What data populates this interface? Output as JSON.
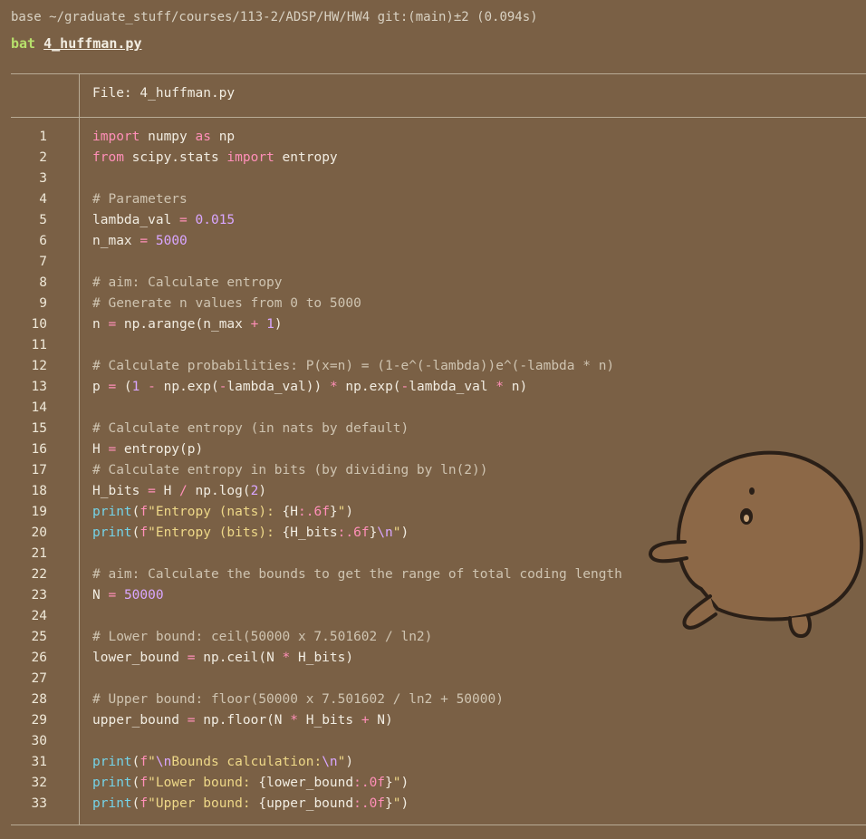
{
  "terminal": {
    "prompt": "base ~/graduate_stuff/courses/113-2/ADSP/HW/HW4 git:(main)±2 (0.094s)",
    "command": "bat",
    "argument": "4_huffman.py"
  },
  "file_header": "File: 4_huffman.py",
  "sticker": {
    "icon": "round-blob-creature-icon"
  },
  "colors": {
    "background": "#7a6045",
    "keyword": "#ff8fb8",
    "number": "#d9a6ff",
    "comment": "#cfc4b1",
    "function": "#74d3e8",
    "string": "#eed888"
  },
  "code": [
    {
      "n": "1",
      "t": [
        [
          "kw",
          "import"
        ],
        [
          "id",
          " numpy "
        ],
        [
          "kw",
          "as"
        ],
        [
          "id",
          " np"
        ]
      ]
    },
    {
      "n": "2",
      "t": [
        [
          "kw",
          "from"
        ],
        [
          "id",
          " scipy.stats "
        ],
        [
          "kw",
          "import"
        ],
        [
          "id",
          " entropy"
        ]
      ]
    },
    {
      "n": "3",
      "t": []
    },
    {
      "n": "4",
      "t": [
        [
          "cmt",
          "# Parameters"
        ]
      ]
    },
    {
      "n": "5",
      "t": [
        [
          "id",
          "lambda_val "
        ],
        [
          "op",
          "="
        ],
        [
          "id",
          " "
        ],
        [
          "num",
          "0.015"
        ]
      ]
    },
    {
      "n": "6",
      "t": [
        [
          "id",
          "n_max "
        ],
        [
          "op",
          "="
        ],
        [
          "id",
          " "
        ],
        [
          "num",
          "5000"
        ]
      ]
    },
    {
      "n": "7",
      "t": []
    },
    {
      "n": "8",
      "t": [
        [
          "cmt",
          "# aim: Calculate entropy"
        ]
      ]
    },
    {
      "n": "9",
      "t": [
        [
          "cmt",
          "# Generate n values from 0 to 5000"
        ]
      ]
    },
    {
      "n": "10",
      "t": [
        [
          "id",
          "n "
        ],
        [
          "op",
          "="
        ],
        [
          "id",
          " np.arange(n_max "
        ],
        [
          "op",
          "+"
        ],
        [
          "id",
          " "
        ],
        [
          "num",
          "1"
        ],
        [
          "id",
          ")"
        ]
      ]
    },
    {
      "n": "11",
      "t": []
    },
    {
      "n": "12",
      "t": [
        [
          "cmt",
          "# Calculate probabilities: P(x=n) = (1-e^(-lambda))e^(-lambda * n)"
        ]
      ]
    },
    {
      "n": "13",
      "t": [
        [
          "id",
          "p "
        ],
        [
          "op",
          "="
        ],
        [
          "id",
          " ("
        ],
        [
          "num",
          "1"
        ],
        [
          "id",
          " "
        ],
        [
          "op",
          "-"
        ],
        [
          "id",
          " np.exp("
        ],
        [
          "op",
          "-"
        ],
        [
          "id",
          "lambda_val)) "
        ],
        [
          "op",
          "*"
        ],
        [
          "id",
          " np.exp("
        ],
        [
          "op",
          "-"
        ],
        [
          "id",
          "lambda_val "
        ],
        [
          "op",
          "*"
        ],
        [
          "id",
          " n)"
        ]
      ]
    },
    {
      "n": "14",
      "t": []
    },
    {
      "n": "15",
      "t": [
        [
          "cmt",
          "# Calculate entropy (in nats by default)"
        ]
      ]
    },
    {
      "n": "16",
      "t": [
        [
          "id",
          "H "
        ],
        [
          "op",
          "="
        ],
        [
          "id",
          " entropy(p)"
        ]
      ]
    },
    {
      "n": "17",
      "t": [
        [
          "cmt",
          "# Calculate entropy in bits (by dividing by ln(2))"
        ]
      ]
    },
    {
      "n": "18",
      "t": [
        [
          "id",
          "H_bits "
        ],
        [
          "op",
          "="
        ],
        [
          "id",
          " H "
        ],
        [
          "op",
          "/"
        ],
        [
          "id",
          " np.log("
        ],
        [
          "num",
          "2"
        ],
        [
          "id",
          ")"
        ]
      ]
    },
    {
      "n": "19",
      "t": [
        [
          "fn",
          "print"
        ],
        [
          "id",
          "("
        ],
        [
          "kw",
          "f"
        ],
        [
          "str",
          "\"Entropy (nats): "
        ],
        [
          "id",
          "{H"
        ],
        [
          "kw",
          ":.6f"
        ],
        [
          "id",
          "}"
        ],
        [
          "str",
          "\""
        ],
        [
          "id",
          ")"
        ]
      ]
    },
    {
      "n": "20",
      "t": [
        [
          "fn",
          "print"
        ],
        [
          "id",
          "("
        ],
        [
          "kw",
          "f"
        ],
        [
          "str",
          "\"Entropy (bits): "
        ],
        [
          "id",
          "{H_bits"
        ],
        [
          "kw",
          ":.6f"
        ],
        [
          "id",
          "}"
        ],
        [
          "esc",
          "\\n"
        ],
        [
          "str",
          "\""
        ],
        [
          "id",
          ")"
        ]
      ]
    },
    {
      "n": "21",
      "t": []
    },
    {
      "n": "22",
      "t": [
        [
          "cmt",
          "# aim: Calculate the bounds to get the range of total coding length"
        ]
      ]
    },
    {
      "n": "23",
      "t": [
        [
          "id",
          "N "
        ],
        [
          "op",
          "="
        ],
        [
          "id",
          " "
        ],
        [
          "num",
          "50000"
        ]
      ]
    },
    {
      "n": "24",
      "t": []
    },
    {
      "n": "25",
      "t": [
        [
          "cmt",
          "# Lower bound: ceil(50000 x 7.501602 / ln2)"
        ]
      ]
    },
    {
      "n": "26",
      "t": [
        [
          "id",
          "lower_bound "
        ],
        [
          "op",
          "="
        ],
        [
          "id",
          " np.ceil(N "
        ],
        [
          "op",
          "*"
        ],
        [
          "id",
          " H_bits)"
        ]
      ]
    },
    {
      "n": "27",
      "t": []
    },
    {
      "n": "28",
      "t": [
        [
          "cmt",
          "# Upper bound: floor(50000 x 7.501602 / ln2 + 50000)"
        ]
      ]
    },
    {
      "n": "29",
      "t": [
        [
          "id",
          "upper_bound "
        ],
        [
          "op",
          "="
        ],
        [
          "id",
          " np.floor(N "
        ],
        [
          "op",
          "*"
        ],
        [
          "id",
          " H_bits "
        ],
        [
          "op",
          "+"
        ],
        [
          "id",
          " N)"
        ]
      ]
    },
    {
      "n": "30",
      "t": []
    },
    {
      "n": "31",
      "t": [
        [
          "fn",
          "print"
        ],
        [
          "id",
          "("
        ],
        [
          "kw",
          "f"
        ],
        [
          "str",
          "\""
        ],
        [
          "esc",
          "\\n"
        ],
        [
          "str",
          "Bounds calculation:"
        ],
        [
          "esc",
          "\\n"
        ],
        [
          "str",
          "\""
        ],
        [
          "id",
          ")"
        ]
      ]
    },
    {
      "n": "32",
      "t": [
        [
          "fn",
          "print"
        ],
        [
          "id",
          "("
        ],
        [
          "kw",
          "f"
        ],
        [
          "str",
          "\"Lower bound: "
        ],
        [
          "id",
          "{lower_bound"
        ],
        [
          "kw",
          ":.0f"
        ],
        [
          "id",
          "}"
        ],
        [
          "str",
          "\""
        ],
        [
          "id",
          ")"
        ]
      ]
    },
    {
      "n": "33",
      "t": [
        [
          "fn",
          "print"
        ],
        [
          "id",
          "("
        ],
        [
          "kw",
          "f"
        ],
        [
          "str",
          "\"Upper bound: "
        ],
        [
          "id",
          "{upper_bound"
        ],
        [
          "kw",
          ":.0f"
        ],
        [
          "id",
          "}"
        ],
        [
          "str",
          "\""
        ],
        [
          "id",
          ")"
        ]
      ]
    }
  ]
}
